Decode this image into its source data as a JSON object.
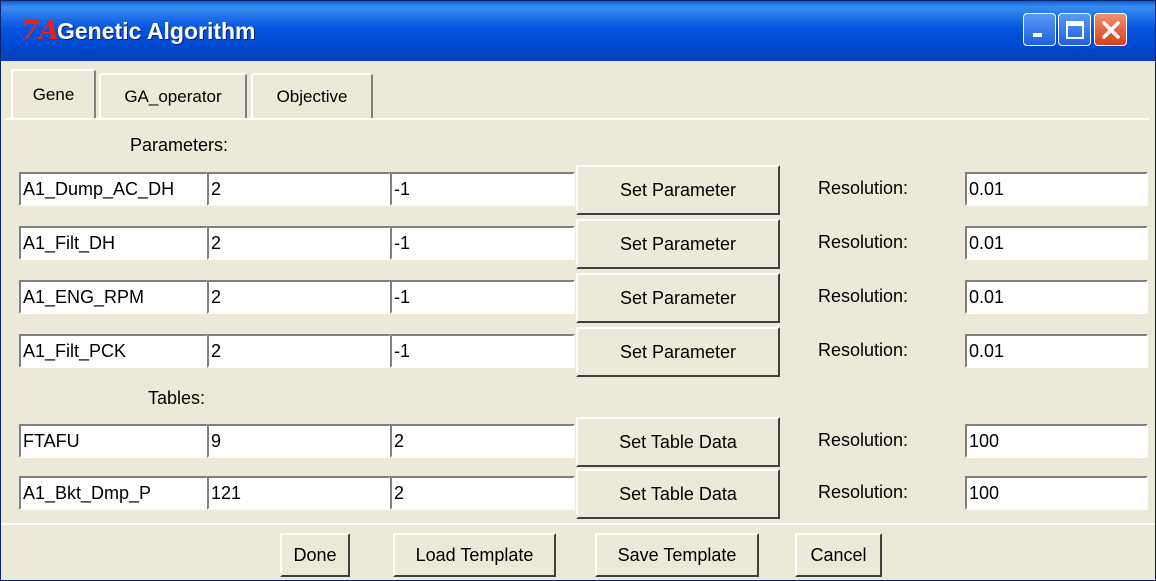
{
  "window": {
    "title": "Genetic Algorithm",
    "icon": "7A"
  },
  "tabs": [
    {
      "label": "Gene",
      "active": true
    },
    {
      "label": "GA_operator",
      "active": false
    },
    {
      "label": "Objective",
      "active": false
    }
  ],
  "parameters": {
    "header": "Parameters:",
    "rows": [
      {
        "name": "A1_Dump_AC_DH",
        "v1": "2",
        "v2": "-1",
        "button": "Set Parameter",
        "res_label": "Resolution:",
        "resolution": "0.01"
      },
      {
        "name": "A1_Filt_DH",
        "v1": "2",
        "v2": "-1",
        "button": "Set Parameter",
        "res_label": "Resolution:",
        "resolution": "0.01"
      },
      {
        "name": "A1_ENG_RPM",
        "v1": "2",
        "v2": "-1",
        "button": "Set Parameter",
        "res_label": "Resolution:",
        "resolution": "0.01"
      },
      {
        "name": "A1_Filt_PCK",
        "v1": "2",
        "v2": "-1",
        "button": "Set Parameter",
        "res_label": "Resolution:",
        "resolution": "0.01"
      }
    ]
  },
  "tables": {
    "header": "Tables:",
    "rows": [
      {
        "name": "FTAFU",
        "v1": "9",
        "v2": "2",
        "button": "Set Table Data",
        "res_label": "Resolution:",
        "resolution": "100"
      },
      {
        "name": "A1_Bkt_Dmp_P",
        "v1": "121",
        "v2": "2",
        "button": "Set Table Data",
        "res_label": "Resolution:",
        "resolution": "100"
      }
    ]
  },
  "footer": {
    "done": "Done",
    "load_template": "Load Template",
    "save_template": "Save Template",
    "cancel": "Cancel"
  },
  "colors": {
    "titlebar": "#0554e0",
    "face": "#ece9d8",
    "close": "#d6401c",
    "icon": "#e8221a"
  }
}
